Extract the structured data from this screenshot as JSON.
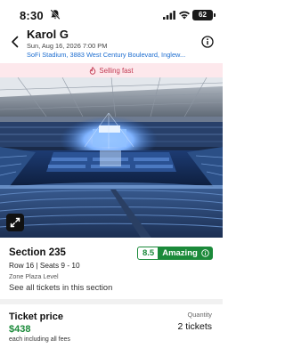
{
  "status_bar": {
    "time": "8:30",
    "battery": "62"
  },
  "header": {
    "title": "Karol G",
    "date": "Sun, Aug 16, 2026 7:00 PM",
    "venue": "SoFi Stadium, 3883 West Century Boulevard, Inglew..."
  },
  "banner": {
    "text": "Selling fast",
    "color": "#c23a52"
  },
  "listing": {
    "section": "Section 235",
    "rating_score": "8.5",
    "rating_label": "Amazing",
    "rating_color": "#1b8a3a",
    "row_seats": "Row 16 | Seats 9 - 10",
    "zone": "Zone Plaza Level",
    "see_all": "See all tickets in this section"
  },
  "price": {
    "label": "Ticket price",
    "value": "$438",
    "note": "each including all fees"
  },
  "quantity": {
    "label": "Quantity",
    "value": "2 tickets"
  }
}
